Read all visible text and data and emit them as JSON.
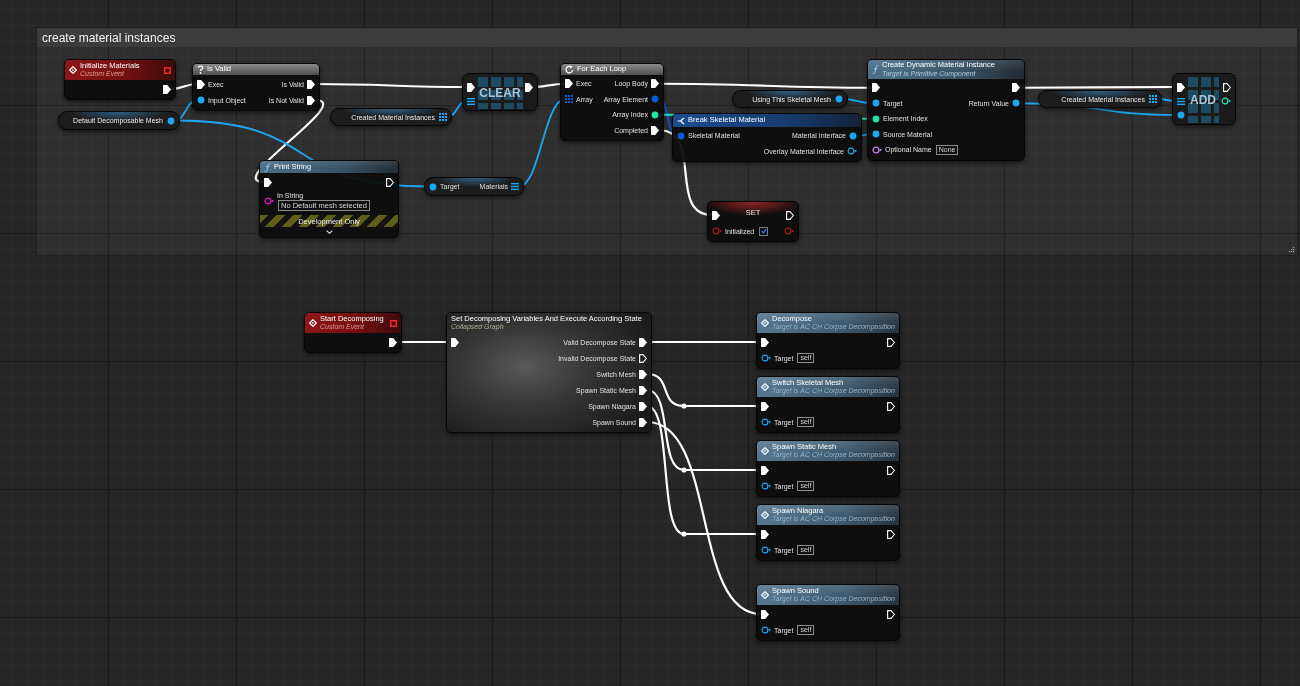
{
  "comment_box": {
    "title": "create material instances",
    "nodes": [
      {
        "kind": "event",
        "title": "Initialize Materials",
        "subtitle": "Custom Event",
        "outputs": [
          {
            "kind": "exec",
            "connected": true
          }
        ]
      },
      {
        "kind": "macro",
        "title": "Is Valid",
        "inputs": [
          {
            "kind": "exec",
            "label": "Exec",
            "connected": true
          },
          {
            "kind": "object",
            "label": "Input Object",
            "connected": true
          }
        ],
        "outputs": [
          {
            "kind": "exec",
            "label": "Is Valid",
            "connected": true
          },
          {
            "kind": "exec",
            "label": "Is Not Valid",
            "connected": true
          }
        ]
      },
      {
        "kind": "loop",
        "title": "For Each Loop",
        "inputs": [
          {
            "kind": "exec",
            "label": "Exec",
            "connected": true
          },
          {
            "kind": "struct_array",
            "label": "Array",
            "connected": true
          }
        ],
        "outputs": [
          {
            "kind": "exec",
            "label": "Loop Body",
            "connected": true
          },
          {
            "kind": "struct",
            "label": "Array Element",
            "connected": true
          },
          {
            "kind": "int",
            "label": "Array Index",
            "connected": true
          },
          {
            "kind": "exec",
            "label": "Completed",
            "connected": true
          }
        ]
      },
      {
        "kind": "function",
        "title": "Create Dynamic Material Instance",
        "subtitle": "Target is Primitive Component",
        "inputs": [
          {
            "kind": "exec",
            "connected": true
          },
          {
            "kind": "object",
            "label": "Target",
            "connected": true
          },
          {
            "kind": "int",
            "label": "Element Index",
            "connected": true
          },
          {
            "kind": "object",
            "label": "Source Material",
            "connected": true
          },
          {
            "kind": "name",
            "label": "Optional Name",
            "value": "None",
            "connected": false
          }
        ],
        "outputs": [
          {
            "kind": "exec",
            "connected": true
          },
          {
            "kind": "object",
            "label": "Return Value",
            "connected": true
          }
        ]
      },
      {
        "kind": "array_op",
        "title": "CLEAR",
        "inputs": [
          {
            "kind": "exec",
            "connected": true
          },
          {
            "kind": "array_ref",
            "connected": true
          }
        ],
        "outputs": [
          {
            "kind": "exec",
            "connected": true
          }
        ]
      },
      {
        "kind": "variable",
        "title": "Using This Skeletal Mesh",
        "outputs": [
          {
            "kind": "object",
            "connected": true
          }
        ]
      },
      {
        "kind": "variable",
        "title": "Created Material Instances",
        "outputs": [
          {
            "kind": "array",
            "connected": true
          }
        ]
      },
      {
        "kind": "array_op",
        "title": "ADD",
        "inputs": [
          {
            "kind": "exec",
            "connected": true
          },
          {
            "kind": "array_ref",
            "connected": true
          },
          {
            "kind": "object",
            "connected": true
          }
        ],
        "outputs": [
          {
            "kind": "exec",
            "connected": false
          },
          {
            "kind": "int",
            "connected": false
          }
        ]
      },
      {
        "kind": "variable",
        "title": "Default Decomposable Mesh",
        "outputs": [
          {
            "kind": "object",
            "connected": true
          }
        ]
      },
      {
        "kind": "variable",
        "title": "Created Material Instances",
        "outputs": [
          {
            "kind": "array",
            "connected": true
          }
        ]
      },
      {
        "kind": "break",
        "title": "Break Skeletal Material",
        "inputs": [
          {
            "kind": "struct",
            "label": "Skeletal Material",
            "connected": true
          }
        ],
        "outputs": [
          {
            "kind": "object",
            "label": "Material Interface",
            "connected": true
          },
          {
            "kind": "object",
            "label": "Overlay Material Interface",
            "connected": false
          }
        ]
      },
      {
        "kind": "function",
        "title": "Print String",
        "inputs": [
          {
            "kind": "exec",
            "connected": true
          },
          {
            "kind": "string",
            "label": "In String",
            "value": "No Default mesh selected",
            "connected": false
          }
        ],
        "outputs": [
          {
            "kind": "exec",
            "connected": false
          }
        ],
        "footer": "Development Only"
      },
      {
        "kind": "pure_compact",
        "inputs": [
          {
            "kind": "object",
            "label": "Target",
            "connected": true
          }
        ],
        "outputs": [
          {
            "kind": "array_ref",
            "label": "Materials",
            "connected": true
          }
        ]
      },
      {
        "kind": "set",
        "title": "SET",
        "inputs": [
          {
            "kind": "exec",
            "connected": true
          },
          {
            "kind": "bool",
            "label": "Initialized",
            "checked": true,
            "connected": false
          }
        ],
        "outputs": [
          {
            "kind": "exec",
            "connected": false
          },
          {
            "kind": "bool",
            "connected": false
          }
        ]
      }
    ]
  },
  "nodes": [
    {
      "kind": "event",
      "title": "Start Decomposing",
      "subtitle": "Custom Event",
      "outputs": [
        {
          "kind": "exec",
          "connected": true
        }
      ]
    },
    {
      "kind": "collapsed",
      "title": "Set Decomposing Variables And Execute According State",
      "subtitle": "Collapsed Graph",
      "inputs": [
        {
          "kind": "exec",
          "connected": true
        }
      ],
      "outputs": [
        {
          "kind": "exec",
          "label": "Valid Decompose State",
          "connected": true
        },
        {
          "kind": "exec",
          "label": "Invalid Decompose State",
          "connected": false
        },
        {
          "kind": "exec",
          "label": "Switch Mesh",
          "connected": true
        },
        {
          "kind": "exec",
          "label": "Spawn Static Mesh",
          "connected": true
        },
        {
          "kind": "exec",
          "label": "Spawn Niagara",
          "connected": true
        },
        {
          "kind": "exec",
          "label": "Spawn Sound",
          "connected": true
        }
      ]
    },
    {
      "kind": "call",
      "title": "Decompose",
      "subtitle": "Target is AC CH Corpse Decomposition",
      "inputs": [
        {
          "kind": "exec",
          "connected": true
        },
        {
          "kind": "object",
          "label": "Target",
          "value": "self",
          "connected": false
        }
      ],
      "outputs": [
        {
          "kind": "exec",
          "connected": false
        }
      ]
    },
    {
      "kind": "call",
      "title": "Switch Skeletal Mesh",
      "subtitle": "Target is AC CH Corpse Decomposition",
      "inputs": [
        {
          "kind": "exec",
          "connected": true
        },
        {
          "kind": "object",
          "label": "Target",
          "value": "self",
          "connected": false
        }
      ],
      "outputs": [
        {
          "kind": "exec",
          "connected": false
        }
      ]
    },
    {
      "kind": "call",
      "title": "Spawn Static Mesh",
      "subtitle": "Target is AC CH Corpse Decomposition",
      "inputs": [
        {
          "kind": "exec",
          "connected": true
        },
        {
          "kind": "object",
          "label": "Target",
          "value": "self",
          "connected": false
        }
      ],
      "outputs": [
        {
          "kind": "exec",
          "connected": false
        }
      ]
    },
    {
      "kind": "call",
      "title": "Spawn Niagara",
      "subtitle": "Target is AC CH Corpse Decomposition",
      "inputs": [
        {
          "kind": "exec",
          "connected": true
        },
        {
          "kind": "object",
          "label": "Target",
          "value": "self",
          "connected": false
        }
      ],
      "outputs": [
        {
          "kind": "exec",
          "connected": false
        }
      ]
    },
    {
      "kind": "call",
      "title": "Spawn Sound",
      "subtitle": "Target is AC CH Corpse Decomposition",
      "inputs": [
        {
          "kind": "exec",
          "connected": true
        },
        {
          "kind": "object",
          "label": "Target",
          "value": "self",
          "connected": false
        }
      ],
      "outputs": [
        {
          "kind": "exec",
          "connected": false
        }
      ]
    }
  ]
}
